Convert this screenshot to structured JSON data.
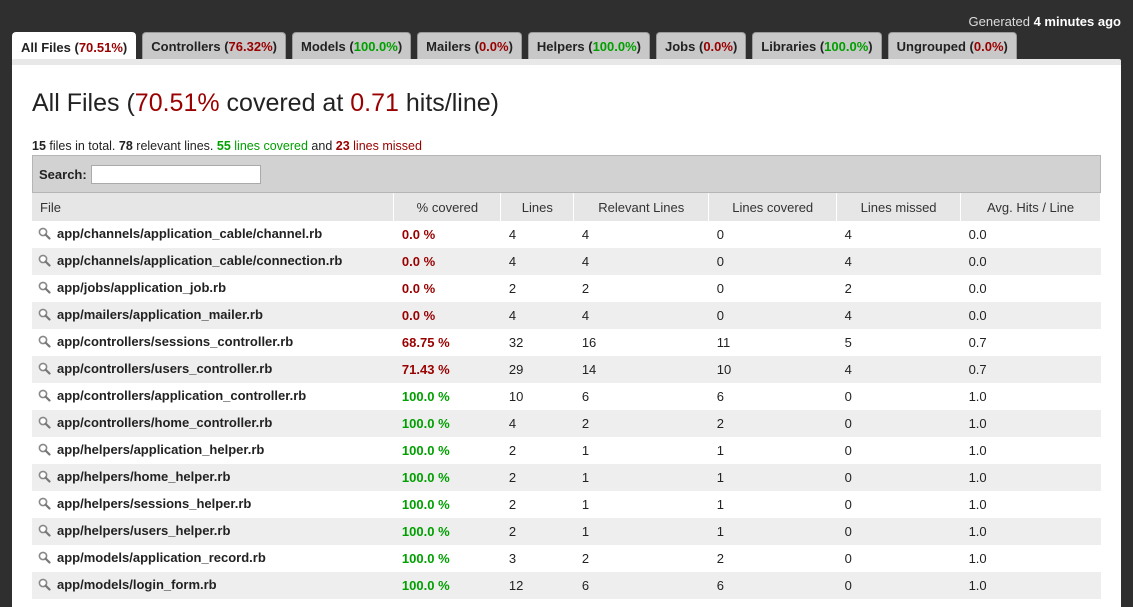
{
  "header": {
    "generated_prefix": "Generated",
    "generated_time": "4 minutes ago"
  },
  "tabs": [
    {
      "label": "All Files",
      "pct": "70.51%",
      "status": "red",
      "active": true
    },
    {
      "label": "Controllers",
      "pct": "76.32%",
      "status": "red"
    },
    {
      "label": "Models",
      "pct": "100.0%",
      "status": "green"
    },
    {
      "label": "Mailers",
      "pct": "0.0%",
      "status": "red"
    },
    {
      "label": "Helpers",
      "pct": "100.0%",
      "status": "green"
    },
    {
      "label": "Jobs",
      "pct": "0.0%",
      "status": "red"
    },
    {
      "label": "Libraries",
      "pct": "100.0%",
      "status": "green"
    },
    {
      "label": "Ungrouped",
      "pct": "0.0%",
      "status": "red"
    }
  ],
  "title": {
    "name": "All Files",
    "pct": "70.51%",
    "mid": "covered at",
    "hits": "0.71",
    "suffix": "hits/line"
  },
  "summary": {
    "files": "15",
    "files_text": "files in total.",
    "relevant": "78",
    "relevant_text": "relevant lines.",
    "covered": "55",
    "covered_text": "lines covered",
    "and": "and",
    "missed": "23",
    "missed_text": "lines missed"
  },
  "search": {
    "label": "Search:",
    "value": ""
  },
  "table": {
    "columns": [
      "File",
      "% covered",
      "Lines",
      "Relevant Lines",
      "Lines covered",
      "Lines missed",
      "Avg. Hits / Line"
    ],
    "rows": [
      [
        "app/channels/application_cable/channel.rb",
        "0.0 %",
        "4",
        "4",
        "0",
        "4",
        "0.0"
      ],
      [
        "app/channels/application_cable/connection.rb",
        "0.0 %",
        "4",
        "4",
        "0",
        "4",
        "0.0"
      ],
      [
        "app/jobs/application_job.rb",
        "0.0 %",
        "2",
        "2",
        "0",
        "2",
        "0.0"
      ],
      [
        "app/mailers/application_mailer.rb",
        "0.0 %",
        "4",
        "4",
        "0",
        "4",
        "0.0"
      ],
      [
        "app/controllers/sessions_controller.rb",
        "68.75 %",
        "32",
        "16",
        "11",
        "5",
        "0.7"
      ],
      [
        "app/controllers/users_controller.rb",
        "71.43 %",
        "29",
        "14",
        "10",
        "4",
        "0.7"
      ],
      [
        "app/controllers/application_controller.rb",
        "100.0 %",
        "10",
        "6",
        "6",
        "0",
        "1.0"
      ],
      [
        "app/controllers/home_controller.rb",
        "100.0 %",
        "4",
        "2",
        "2",
        "0",
        "1.0"
      ],
      [
        "app/helpers/application_helper.rb",
        "100.0 %",
        "2",
        "1",
        "1",
        "0",
        "1.0"
      ],
      [
        "app/helpers/home_helper.rb",
        "100.0 %",
        "2",
        "1",
        "1",
        "0",
        "1.0"
      ],
      [
        "app/helpers/sessions_helper.rb",
        "100.0 %",
        "2",
        "1",
        "1",
        "0",
        "1.0"
      ],
      [
        "app/helpers/users_helper.rb",
        "100.0 %",
        "2",
        "1",
        "1",
        "0",
        "1.0"
      ],
      [
        "app/models/application_record.rb",
        "100.0 %",
        "3",
        "2",
        "2",
        "0",
        "1.0"
      ],
      [
        "app/models/login_form.rb",
        "100.0 %",
        "12",
        "6",
        "6",
        "0",
        "1.0"
      ]
    ]
  },
  "colors": {
    "red": "#990000",
    "green": "#00a000"
  }
}
